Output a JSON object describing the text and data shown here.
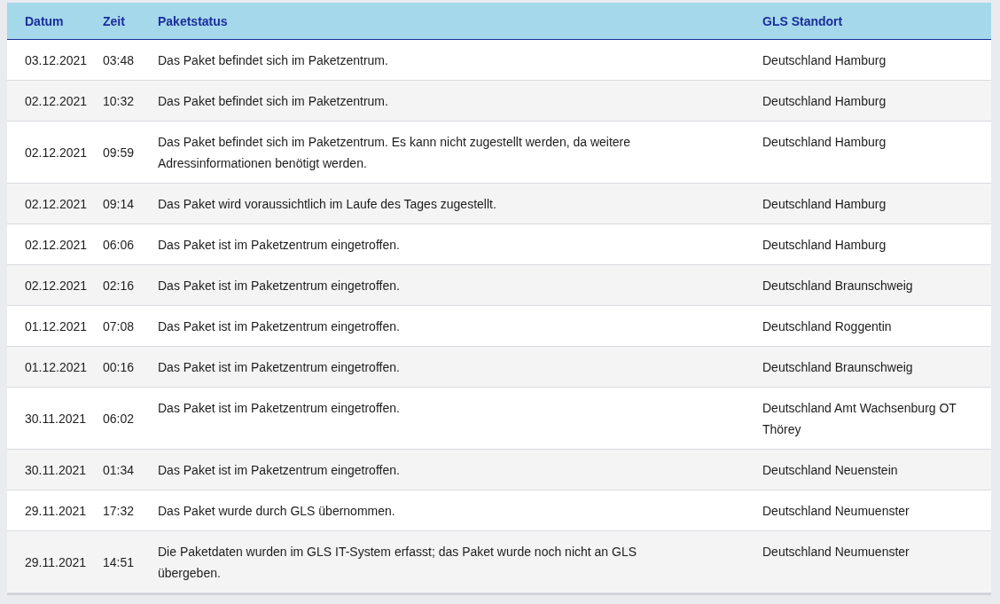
{
  "table": {
    "columns": [
      "Datum",
      "Zeit",
      "Paketstatus",
      "GLS Standort"
    ],
    "rows": [
      {
        "date": "03.12.2021",
        "time": "03:48",
        "status": "Das Paket befindet sich im Paketzentrum.",
        "location": "Deutschland Hamburg"
      },
      {
        "date": "02.12.2021",
        "time": "10:32",
        "status": "Das Paket befindet sich im Paketzentrum.",
        "location": "Deutschland Hamburg"
      },
      {
        "date": "02.12.2021",
        "time": "09:59",
        "status": "Das Paket befindet sich im Paketzentrum. Es kann nicht zugestellt werden, da weitere Adressinformationen benötigt werden.",
        "location": "Deutschland Hamburg"
      },
      {
        "date": "02.12.2021",
        "time": "09:14",
        "status": "Das Paket wird voraussichtlich im Laufe des Tages zugestellt.",
        "location": "Deutschland Hamburg"
      },
      {
        "date": "02.12.2021",
        "time": "06:06",
        "status": "Das Paket ist im Paketzentrum eingetroffen.",
        "location": "Deutschland Hamburg"
      },
      {
        "date": "02.12.2021",
        "time": "02:16",
        "status": "Das Paket ist im Paketzentrum eingetroffen.",
        "location": "Deutschland Braunschweig"
      },
      {
        "date": "01.12.2021",
        "time": "07:08",
        "status": "Das Paket ist im Paketzentrum eingetroffen.",
        "location": "Deutschland Roggentin"
      },
      {
        "date": "01.12.2021",
        "time": "00:16",
        "status": "Das Paket ist im Paketzentrum eingetroffen.",
        "location": "Deutschland Braunschweig"
      },
      {
        "date": "30.11.2021",
        "time": "06:02",
        "status": "Das Paket ist im Paketzentrum eingetroffen.",
        "location": "Deutschland Amt Wachsenburg OT Thörey"
      },
      {
        "date": "30.11.2021",
        "time": "01:34",
        "status": "Das Paket ist im Paketzentrum eingetroffen.",
        "location": "Deutschland Neuenstein"
      },
      {
        "date": "29.11.2021",
        "time": "17:32",
        "status": "Das Paket wurde durch GLS übernommen.",
        "location": "Deutschland Neumuenster"
      },
      {
        "date": "29.11.2021",
        "time": "14:51",
        "status": "Die Paketdaten wurden im GLS IT-System erfasst; das Paket wurde noch nicht an GLS übergeben.",
        "location": "Deutschland Neumuenster"
      }
    ]
  }
}
